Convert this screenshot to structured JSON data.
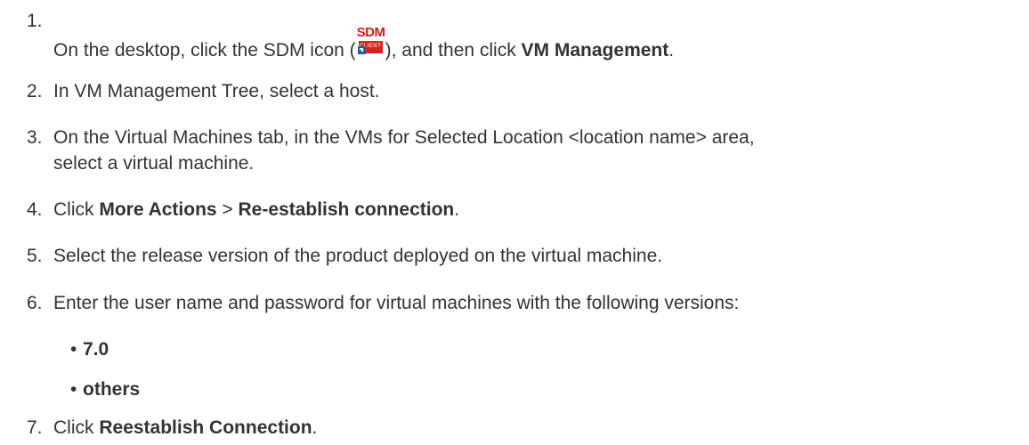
{
  "steps": [
    {
      "num": "1.",
      "pre": "On the desktop, click the SDM icon (",
      "post": "), and then click ",
      "bold": "VM Management",
      "end": "."
    },
    {
      "num": "2.",
      "text": "In VM Management Tree, select a host."
    },
    {
      "num": "3.",
      "line1": "On the Virtual Machines tab, in the VMs for Selected Location <location name> area,",
      "line2": "select a virtual machine."
    },
    {
      "num": "4.",
      "pre": "Click ",
      "bold1": "More Actions",
      "mid": " > ",
      "bold2": "Re-establish connection",
      "end": "."
    },
    {
      "num": "5.",
      "text": "Select the release version of the product deployed on the virtual machine."
    },
    {
      "num": "6.",
      "text": "Enter the user name and password for virtual machines with the following versions:",
      "bullets": [
        "7.0",
        "others"
      ]
    },
    {
      "num": "7.",
      "pre": "Click ",
      "bold": "Reestablish Connection",
      "end": "."
    }
  ],
  "icon": {
    "name": "sdm-client-icon",
    "top_label": "SDM",
    "box_label": "CLIENT",
    "brand_color": "#d8241c"
  }
}
